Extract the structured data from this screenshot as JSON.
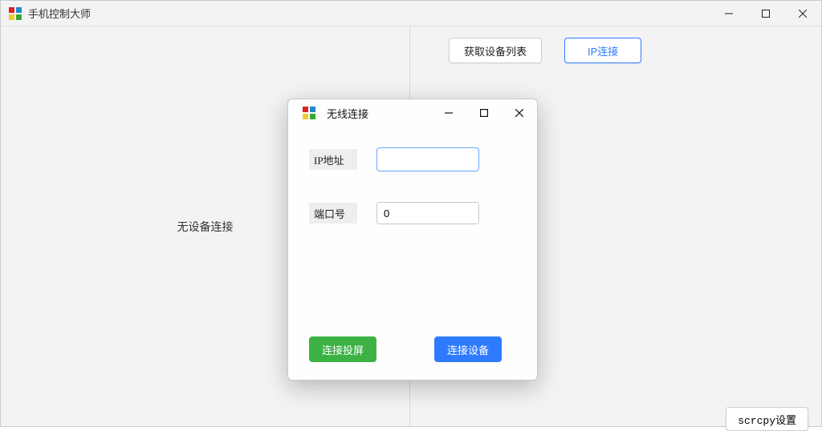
{
  "window": {
    "title": "手机控制大师"
  },
  "main": {
    "no_device_text": "无设备连接",
    "get_devices_label": "获取设备列表",
    "ip_connect_label": "IP连接",
    "scrcpy_settings_label": "scrcpy设置"
  },
  "dialog": {
    "title": "无线连接",
    "ip_label": "IP地址",
    "ip_value": "",
    "port_label": "端口号",
    "port_value": "0",
    "connect_mirror_label": "连接投屏",
    "connect_device_label": "连接设备"
  }
}
